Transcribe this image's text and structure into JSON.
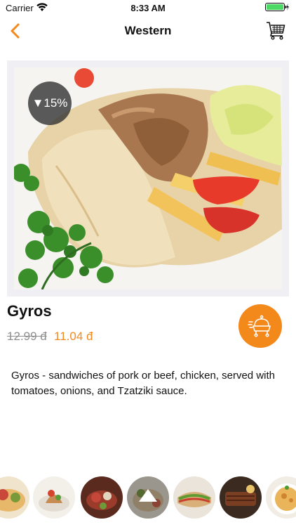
{
  "status_bar": {
    "carrier": "Carrier",
    "time": "8:33 AM"
  },
  "nav": {
    "title": "Western",
    "back_icon": "chevron-left-icon",
    "cart_icon": "cart-icon"
  },
  "product": {
    "discount_label": "▼15%",
    "name": "Gyros",
    "old_price": "12.99 đ",
    "new_price": "11.04 đ",
    "description": "Gyros - sandwiches of pork or beef, chicken, served with tomatoes, onions, and Tzatziki sauce."
  },
  "actions": {
    "order_icon": "food-delivery-icon"
  },
  "thumbnails": {
    "selected_icon": "triangle-up-icon"
  },
  "colors": {
    "accent": "#f3881b",
    "frame": "#efeff4",
    "battery": "#4cd964"
  }
}
